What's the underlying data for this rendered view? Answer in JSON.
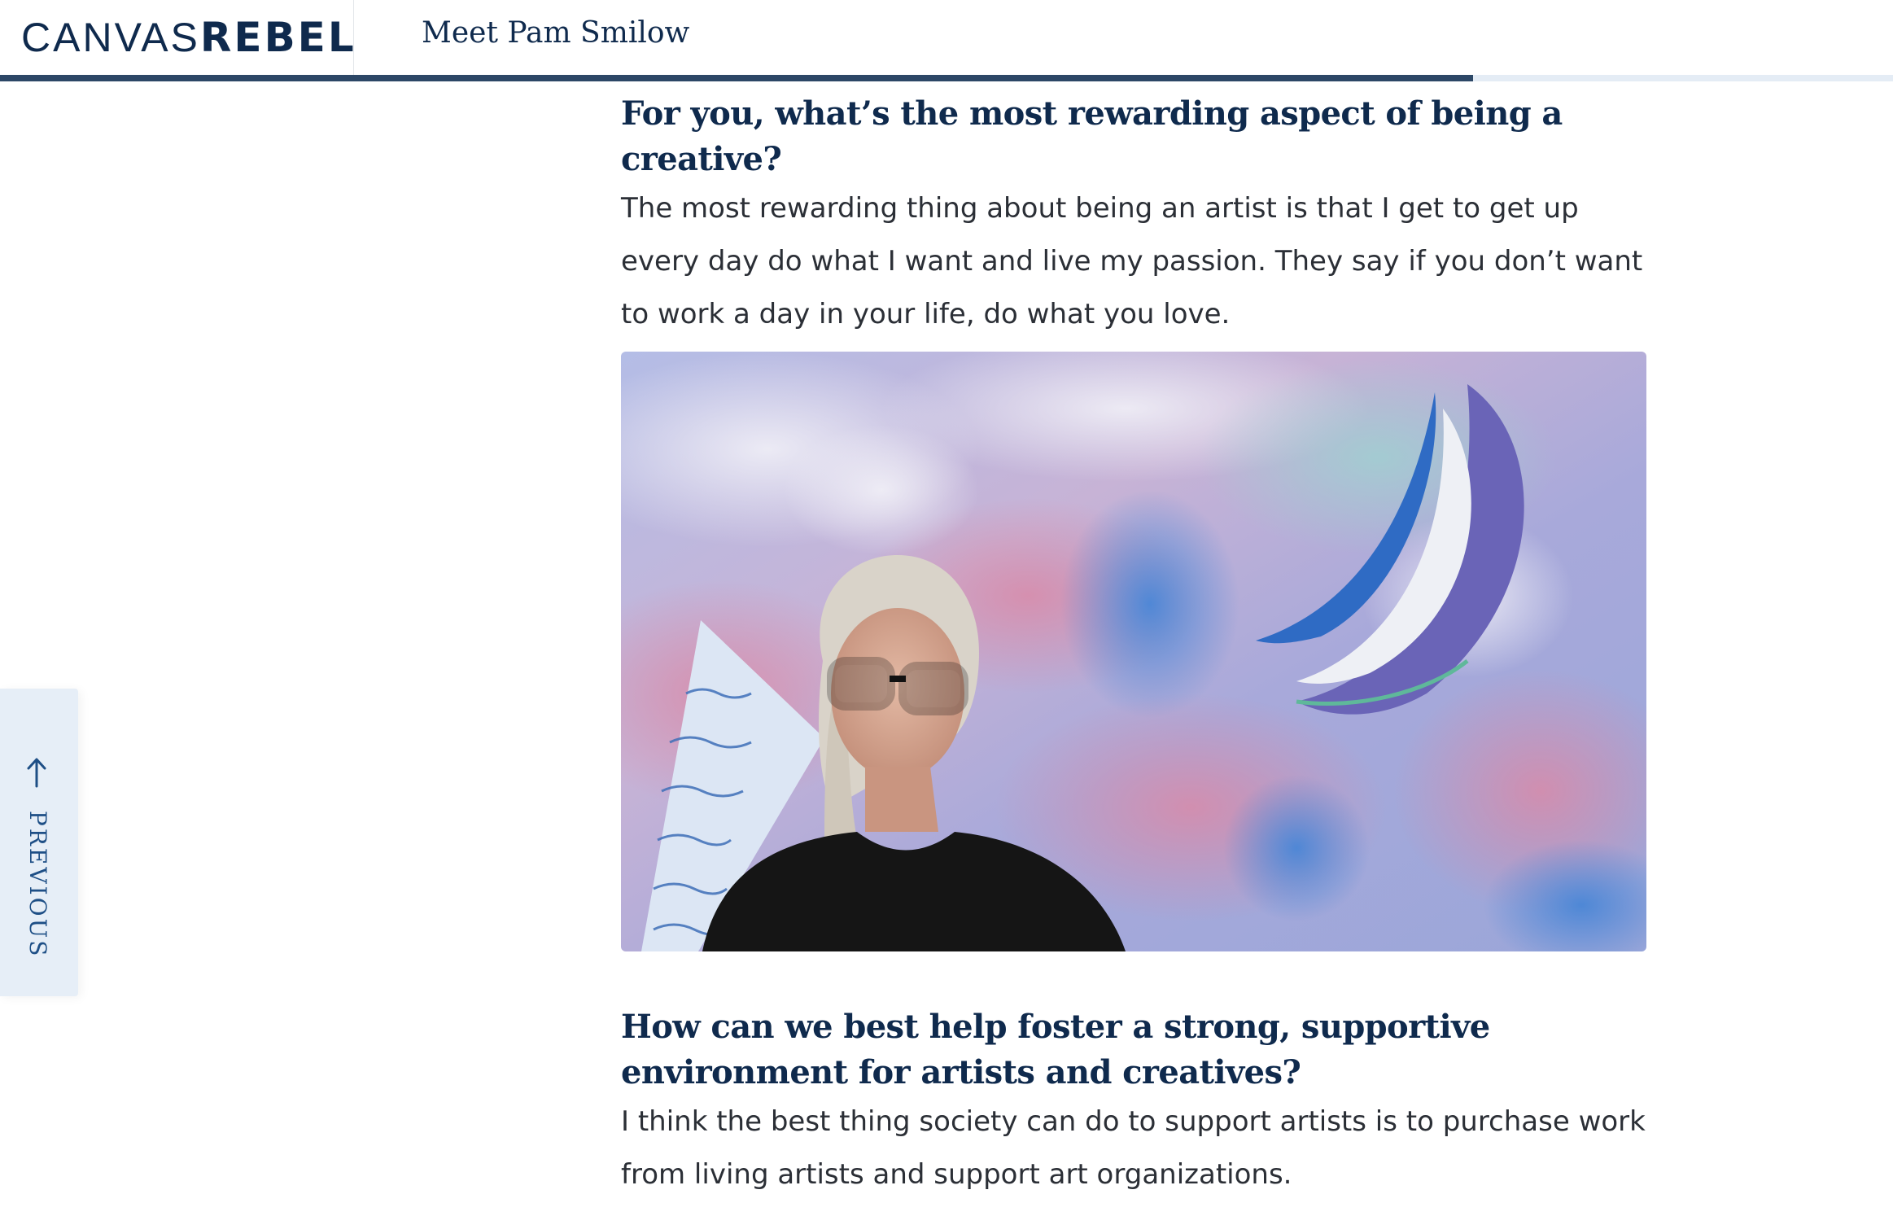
{
  "header": {
    "logo_light": "CANVAS",
    "logo_bold": "REBEL",
    "title": "Meet Pam Smilow",
    "reading_progress": 0.778
  },
  "article": {
    "sections": [
      {
        "question": "For you, what’s the most rewarding aspect of being a creative?",
        "answer": "The most rewarding thing about being an artist is that I get to get up every day do what I want and live my passion. They say if you don’t want to work a day in your life, do what you love."
      },
      {
        "question": "How can we best help foster a strong, supportive environment for artists and creatives?",
        "answer": "I think the best thing society can do to support artists is to purchase work from living artists and support art organizations."
      }
    ]
  },
  "nav": {
    "previous_label": "PREVIOUS",
    "previous_icon": "arrow-up-icon"
  },
  "colors": {
    "brand_navy": "#0f2a4d",
    "progress_fill": "#2c4766",
    "progress_track": "#e4ecf5",
    "tab_background": "#e6eef7",
    "tab_text": "#1e4f86"
  }
}
